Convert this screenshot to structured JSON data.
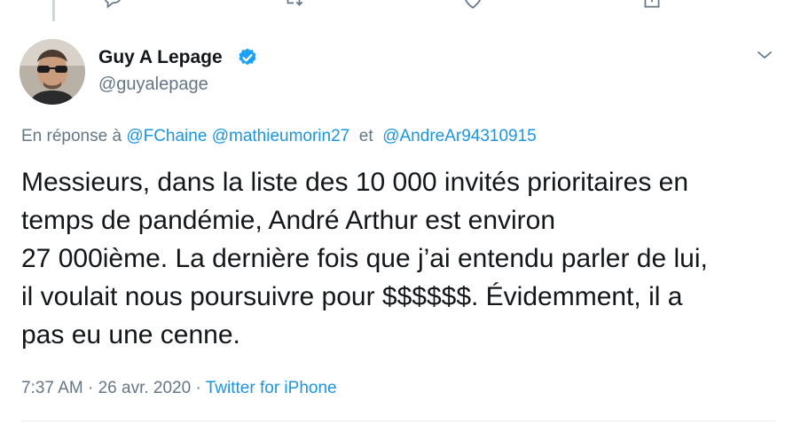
{
  "previous_tweet_actions": {
    "reply_icon": "reply-icon",
    "retweet_icon": "retweet-icon",
    "like_icon": "heart-icon",
    "share_icon": "share-icon"
  },
  "tweet": {
    "author": {
      "display_name": "Guy A Lepage",
      "handle": "@guyalepage",
      "verified": true
    },
    "reply_to": {
      "prefix": "En réponse à",
      "mentions": [
        "@FChaine",
        "@mathieumorin27",
        "@AndreAr94310915"
      ],
      "separator": "et"
    },
    "text": "Messieurs, dans la liste des 10 000 invités prioritaires en\ntemps de pandémie, André Arthur est environ\n27 000ième. La dernière fois que j’ai entendu parler de lui,\nil voulait nous poursuivre pour $$$$$$. Évidemment, il a\npas eu une cenne.",
    "time": "7:37 AM",
    "date": "26 avr. 2020",
    "dot": "·",
    "source": "Twitter for iPhone"
  },
  "colors": {
    "link": "#1b95e0",
    "muted": "#657786",
    "text": "#14171a",
    "verified": "#1da1f2"
  }
}
